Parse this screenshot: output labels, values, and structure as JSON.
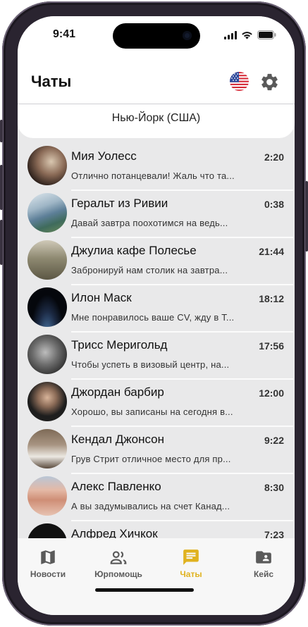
{
  "status_bar": {
    "time": "9:41"
  },
  "header": {
    "title": "Чаты",
    "city": "Нью-Йорк (США)"
  },
  "chats": [
    {
      "name": "Мия Уолесс",
      "time": "2:20",
      "preview": "Отлично потанцевали! Жаль что та...",
      "avatar_color": "#8a6a56"
    },
    {
      "name": "Геральт из Ривии",
      "time": "0:38",
      "preview": "Давай завтра поохотимся на ведь...",
      "avatar_color": "#6f8fa8"
    },
    {
      "name": "Джулиа кафе Полесье",
      "time": "21:44",
      "preview": "Забронируй нам столик на завтра...",
      "avatar_color": "#7a7560"
    },
    {
      "name": "Илон Маск",
      "time": "18:12",
      "preview": "Мне понравилось ваше CV, жду в Т...",
      "avatar_color": "#0d0f14"
    },
    {
      "name": "Трисс Меригольд",
      "time": "17:56",
      "preview": "Чтобы успеть в визовый центр, на...",
      "avatar_color": "#4a4a4a"
    },
    {
      "name": "Джордан барбир",
      "time": "12:00",
      "preview": "Хорошо, вы записаны на сегодня в...",
      "avatar_color": "#2c2c2c"
    },
    {
      "name": "Кендал Джонсон",
      "time": "9:22",
      "preview": "Грув Стрит отличное место для пр...",
      "avatar_color": "#6b5a4a"
    },
    {
      "name": "Алекс Павленко",
      "time": "8:30",
      "preview": "А вы задумывались на счет Канад...",
      "avatar_color": "#c99a86"
    },
    {
      "name": "Алфред Хичкок",
      "time": "7:23",
      "preview": "",
      "avatar_color": "#111111"
    }
  ],
  "tabs": [
    {
      "label": "Новости",
      "icon": "map-icon",
      "active": false
    },
    {
      "label": "Юрпомощь",
      "icon": "people-icon",
      "active": false
    },
    {
      "label": "Чаты",
      "icon": "chat-icon",
      "active": true
    },
    {
      "label": "Кейс",
      "icon": "folder-icon",
      "active": false
    }
  ],
  "colors": {
    "accent": "#e0b21f",
    "background": "#e9e9ea"
  }
}
